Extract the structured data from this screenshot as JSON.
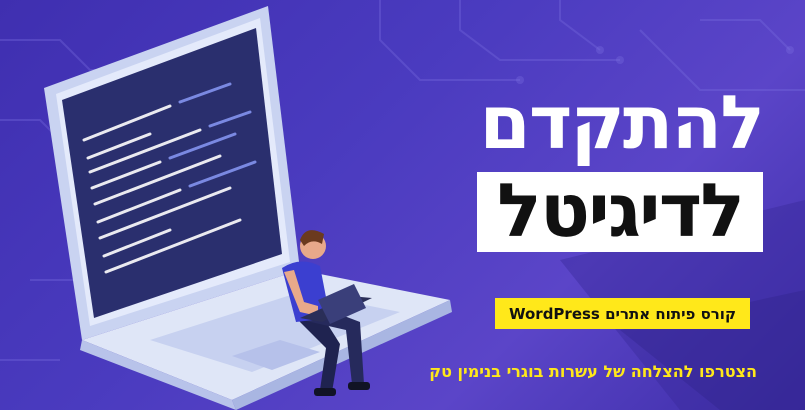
{
  "headline": {
    "line1": "להתקדם",
    "line2": "לדיגיטל"
  },
  "course": {
    "label": "קורס פיתוח אתרים WordPress"
  },
  "tagline": "הצטרפו להצלחה של עשרות בוגרי בנימין טק",
  "colors": {
    "background": "#4a3bbf",
    "accent_yellow": "#ffe81a",
    "laptop_body": "#dfe6f7",
    "screen": "#2a2f6e"
  }
}
